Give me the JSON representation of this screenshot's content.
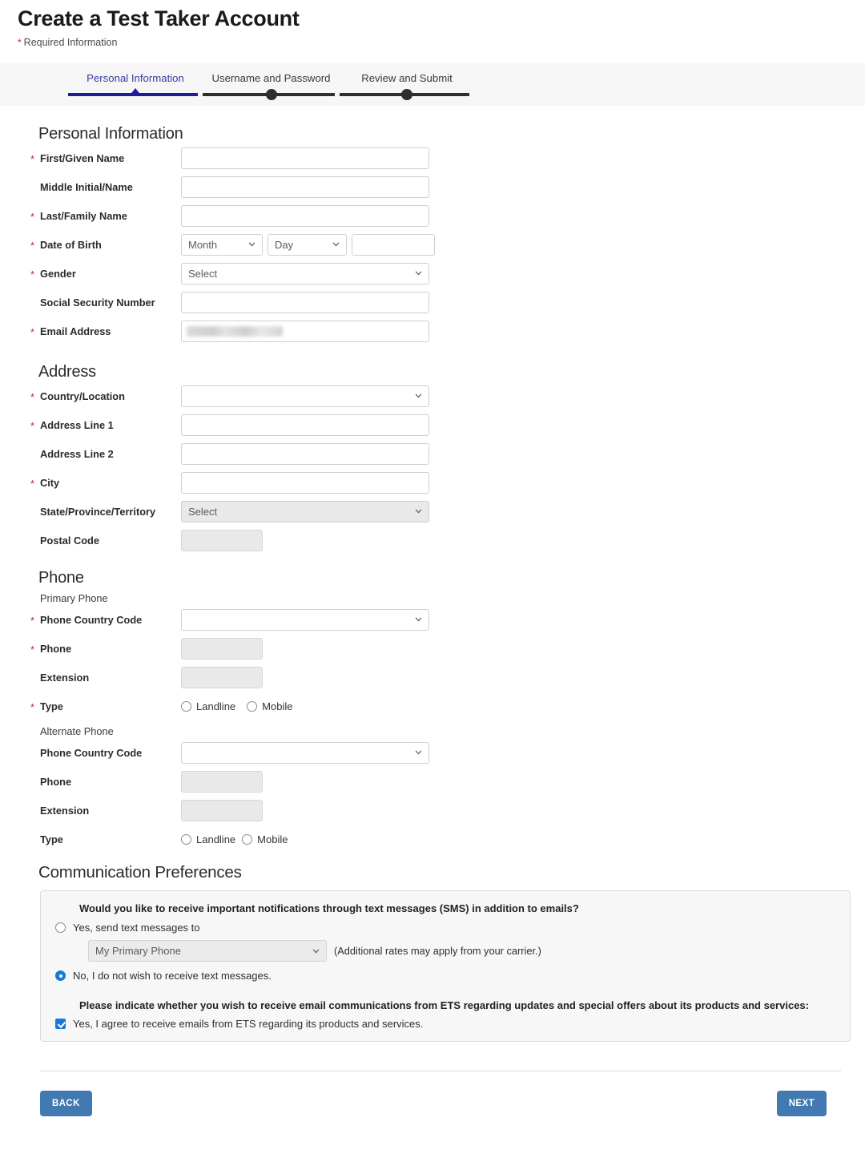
{
  "header": {
    "title": "Create a Test Taker Account",
    "required_note": "Required Information",
    "required_star": "*"
  },
  "stepper": {
    "steps": [
      {
        "label": "Personal Information",
        "state": "active"
      },
      {
        "label": "Username and Password",
        "state": "upcoming"
      },
      {
        "label": "Review and Submit",
        "state": "upcoming"
      }
    ]
  },
  "sections": {
    "personal": {
      "heading": "Personal Information",
      "fields": {
        "first_name": {
          "label": "First/Given Name",
          "required": true,
          "value": ""
        },
        "middle_name": {
          "label": "Middle Initial/Name",
          "required": false,
          "value": ""
        },
        "last_name": {
          "label": "Last/Family Name",
          "required": true,
          "value": ""
        },
        "dob": {
          "label": "Date of Birth",
          "required": true,
          "month": "Month",
          "day": "Day",
          "year": ""
        },
        "gender": {
          "label": "Gender",
          "required": true,
          "value": "Select"
        },
        "ssn": {
          "label": "Social Security Number",
          "required": false,
          "value": ""
        },
        "email": {
          "label": "Email Address",
          "required": true,
          "value": "",
          "redacted": true
        }
      }
    },
    "address": {
      "heading": "Address",
      "fields": {
        "country": {
          "label": "Country/Location",
          "required": true,
          "value": ""
        },
        "line1": {
          "label": "Address Line 1",
          "required": true,
          "value": ""
        },
        "line2": {
          "label": "Address Line 2",
          "required": false,
          "value": ""
        },
        "city": {
          "label": "City",
          "required": true,
          "value": ""
        },
        "state": {
          "label": "State/Province/Territory",
          "required": false,
          "value": "Select"
        },
        "postal": {
          "label": "Postal Code",
          "required": false,
          "value": ""
        }
      }
    },
    "phone": {
      "heading": "Phone",
      "primary_subhead": "Primary Phone",
      "alternate_subhead": "Alternate Phone",
      "primary": {
        "country_code": {
          "label": "Phone Country Code",
          "required": true,
          "value": ""
        },
        "number": {
          "label": "Phone",
          "required": true,
          "value": ""
        },
        "extension": {
          "label": "Extension",
          "required": false,
          "value": ""
        },
        "type": {
          "label": "Type",
          "required": true,
          "options": [
            {
              "label": "Landline",
              "selected": false
            },
            {
              "label": "Mobile",
              "selected": false
            }
          ]
        }
      },
      "alternate": {
        "country_code": {
          "label": "Phone Country Code",
          "required": false,
          "value": ""
        },
        "number": {
          "label": "Phone",
          "required": false,
          "value": ""
        },
        "extension": {
          "label": "Extension",
          "required": false,
          "value": ""
        },
        "type": {
          "label": "Type",
          "required": false,
          "options": [
            {
              "label": "Landline",
              "selected": false
            },
            {
              "label": "Mobile",
              "selected": false
            }
          ]
        }
      }
    },
    "communication": {
      "heading": "Communication Preferences",
      "sms_question": "Would you like to receive important notifications through text messages (SMS) in addition to emails?",
      "sms_yes_label": "Yes, send text messages to",
      "sms_yes_selected": false,
      "sms_target_value": "My Primary Phone",
      "sms_rates_note": "(Additional rates may apply from your carrier.)",
      "sms_no_label": "No, I do not wish to receive text messages.",
      "sms_no_selected": true,
      "email_question": "Please indicate whether you wish to receive email communications from ETS regarding updates and special offers about its products and services:",
      "email_consent_label": "Yes, I agree to receive emails from ETS regarding its products and services.",
      "email_consent_checked": true
    }
  },
  "footer": {
    "back_label": "BACK",
    "next_label": "NEXT"
  },
  "colors": {
    "active_step": "#1d1d9c",
    "inactive_step": "#2e2e2e",
    "required_star": "#b03030",
    "button": "#4279b0",
    "selection_blue": "#1878d8",
    "band_bg": "#f6f6f6",
    "comm_box_bg": "#f7f7f7",
    "disabled_field": "#e9e9e9"
  }
}
